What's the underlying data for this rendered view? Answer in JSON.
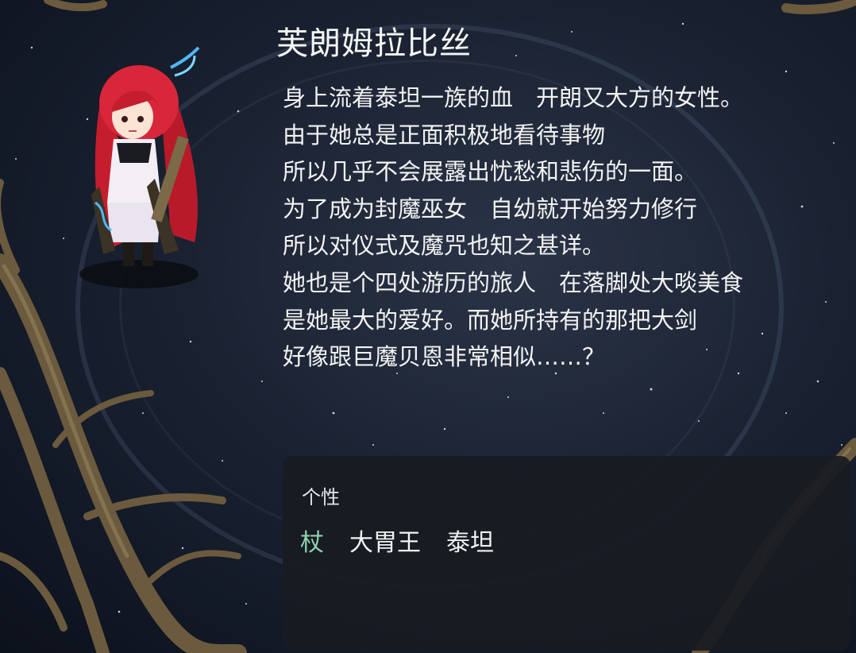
{
  "character": {
    "name": "芙朗姆拉比丝",
    "description_lines": [
      "身上流着泰坦一族的血　开朗又大方的女性。",
      "由于她总是正面积极地看待事物",
      "所以几乎不会展露出忧愁和悲伤的一面。",
      "为了成为封魔巫女　自幼就开始努力修行",
      "所以对仪式及魔咒也知之甚详。",
      "她也是个四处游历的旅人　在落脚处大啖美食",
      "是她最大的爱好。而她所持有的那把大剑",
      "好像跟巨魔贝恩非常相似……？"
    ]
  },
  "traits_panel": {
    "label": "个性",
    "traits": [
      "杖",
      "大胃王",
      "泰坦"
    ],
    "highlight_color": "#8fd1ae"
  }
}
